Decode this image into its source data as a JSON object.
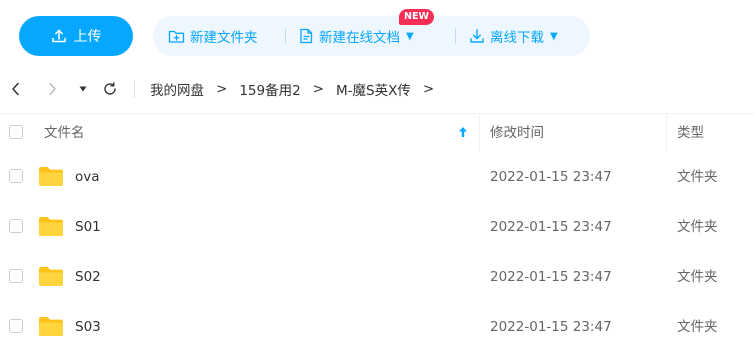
{
  "toolbar": {
    "upload_label": "上传",
    "new_folder_label": "新建文件夹",
    "new_online_doc_label": "新建在线文档",
    "new_badge": "NEW",
    "offline_download_label": "离线下载",
    "accent_color": "#06a7ff",
    "badge_color": "#f72f54"
  },
  "breadcrumb": {
    "items": [
      "我的网盘",
      "159备用2",
      "M-魔S英X传"
    ],
    "separator": ">"
  },
  "table": {
    "columns": {
      "name": "文件名",
      "modified": "修改时间",
      "type": "类型"
    },
    "rows": [
      {
        "name": "ova",
        "modified": "2022-01-15 23:47",
        "type": "文件夹",
        "icon": "folder-icon"
      },
      {
        "name": "S01",
        "modified": "2022-01-15 23:47",
        "type": "文件夹",
        "icon": "folder-icon"
      },
      {
        "name": "S02",
        "modified": "2022-01-15 23:47",
        "type": "文件夹",
        "icon": "folder-icon"
      },
      {
        "name": "S03",
        "modified": "2022-01-15 23:47",
        "type": "文件夹",
        "icon": "folder-icon"
      }
    ]
  }
}
